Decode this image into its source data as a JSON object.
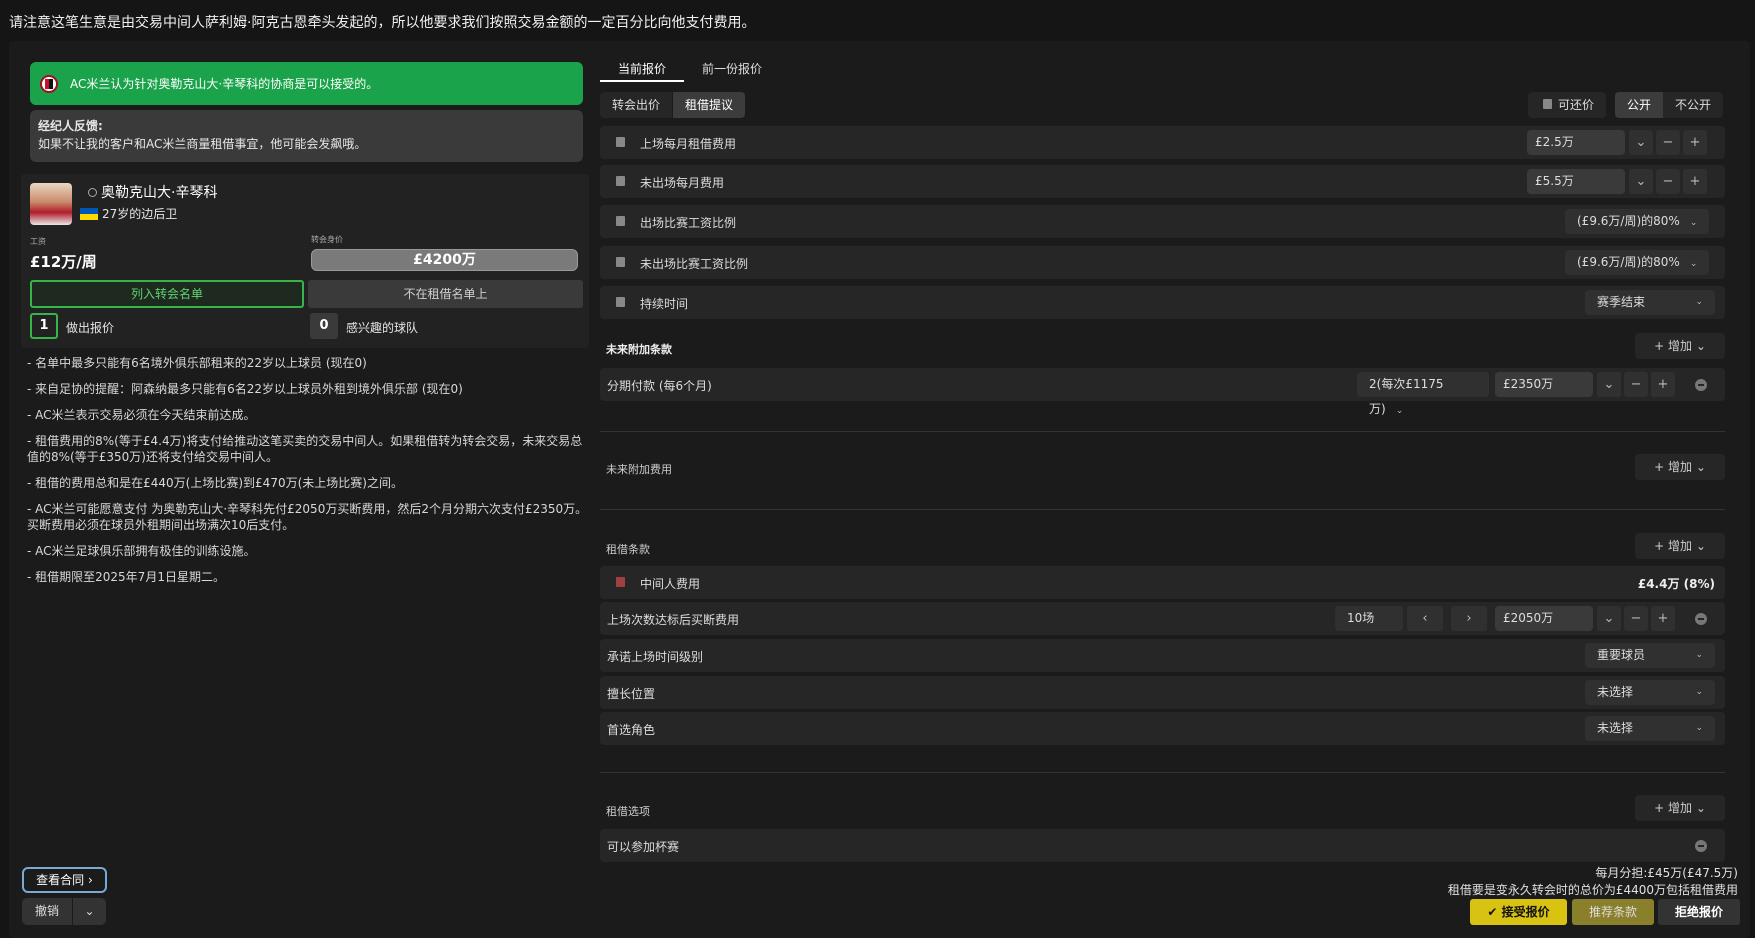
{
  "notice": "请注意这笔生意是由交易中间人萨利姆·阿克古恩牵头发起的，所以他要求我们按照交易金额的一定百分比向他支付费用。",
  "approval": "AC米兰认为针对奥勒克山大·辛琴科的协商是可以接受的。",
  "agent": {
    "title": "经纪人反馈:",
    "text": "如果不让我的客户和AC米兰商量租借事宜，他可能会发飙哦。"
  },
  "player": {
    "name": "奥勒克山大·辛琴科",
    "age_pos": "27岁的边后卫",
    "wage_label": "工资",
    "wage": "£12万/周",
    "value_label": "转会身价",
    "value": "£4200万",
    "btn_list": "列入转会名单",
    "btn_loan": "不在租借名单上",
    "offers_count": "1",
    "offers_label": "做出报价",
    "interested_count": "0",
    "interested_label": "感兴趣的球队"
  },
  "notes": [
    "- 名单中最多只能有6名境外俱乐部租来的22岁以上球员 (现在0)",
    "- 来自足协的提醒：阿森纳最多只能有6名22岁以上球员外租到境外俱乐部 (现在0)",
    "- AC米兰表示交易必须在今天结束前达成。",
    "- 租借费用的8%(等于£4.4万)将支付给推动这笔买卖的交易中间人。如果租借转为转会交易，未来交易总值的8%(等于£350万)还将支付给交易中间人。",
    "- 租借的费用总和是在£440万(上场比赛)到£470万(未上场比赛)之间。",
    "- AC米兰可能愿意支付 为奥勒克山大·辛琴科先付£2050万买断费用，然后2个月分期六次支付£2350万。买断费用必须在球员外租期间出场满次10后支付。",
    "- AC米兰足球俱乐部拥有极佳的训练设施。",
    "- 租借期限至2025年7月1日星期二。"
  ],
  "left_buttons": {
    "contract": "查看合同",
    "contract_arrow": "›",
    "undo": "撤销",
    "undo_arrow": "⌄"
  },
  "tabs": [
    "当前报价",
    "前一份报价"
  ],
  "segments": [
    "转会出价",
    "租借提议"
  ],
  "negotiable": "可还价",
  "visibility": [
    "公开",
    "不公开"
  ],
  "rows": {
    "monthly_played": {
      "label": "上场每月租借费用",
      "value": "£2.5万"
    },
    "monthly_unplayed": {
      "label": "未出场每月费用",
      "value": "£5.5万"
    },
    "wage_played": {
      "label": "出场比赛工资比例",
      "value": "(£9.6万/周)的80%"
    },
    "wage_unplayed": {
      "label": "未出场比赛工资比例",
      "value": "(£9.6万/周)的80%"
    },
    "duration": {
      "label": "持续时间",
      "value": "赛季结束"
    }
  },
  "future_clauses": {
    "title": "未来附加条款",
    "add": "增加",
    "installment_label": "分期付款 (每6个月)",
    "installment_count": "2(每次£1175万)",
    "installment_value": "£2350万"
  },
  "future_fees": {
    "title": "未来附加费用",
    "add": "增加"
  },
  "loan_terms": {
    "title": "租借条款",
    "add": "增加",
    "agent_fee_label": "中间人费用",
    "agent_fee_value": "£4.4万 (8%)",
    "buyout_label": "上场次数达标后买断费用",
    "buyout_apps": "10场",
    "buyout_value": "£2050万",
    "playing_time_label": "承诺上场时间级别",
    "playing_time_value": "重要球员",
    "position_label": "擅长位置",
    "position_value": "未选择",
    "role_label": "首选角色",
    "role_value": "未选择"
  },
  "loan_options": {
    "title": "租借选项",
    "add": "增加",
    "cup_label": "可以参加杯赛"
  },
  "summary": [
    "每月分担:£45万(£47.5万)",
    "租借要是变永久转会时的总价为£4400万包括租借费用"
  ],
  "actions": {
    "accept": "接受报价",
    "recommend": "推荐条款",
    "reject": "拒绝报价"
  },
  "icons": {
    "plus": "+",
    "minus": "−",
    "chevron": "⌄",
    "left": "‹",
    "right": "›",
    "check": "✔"
  }
}
